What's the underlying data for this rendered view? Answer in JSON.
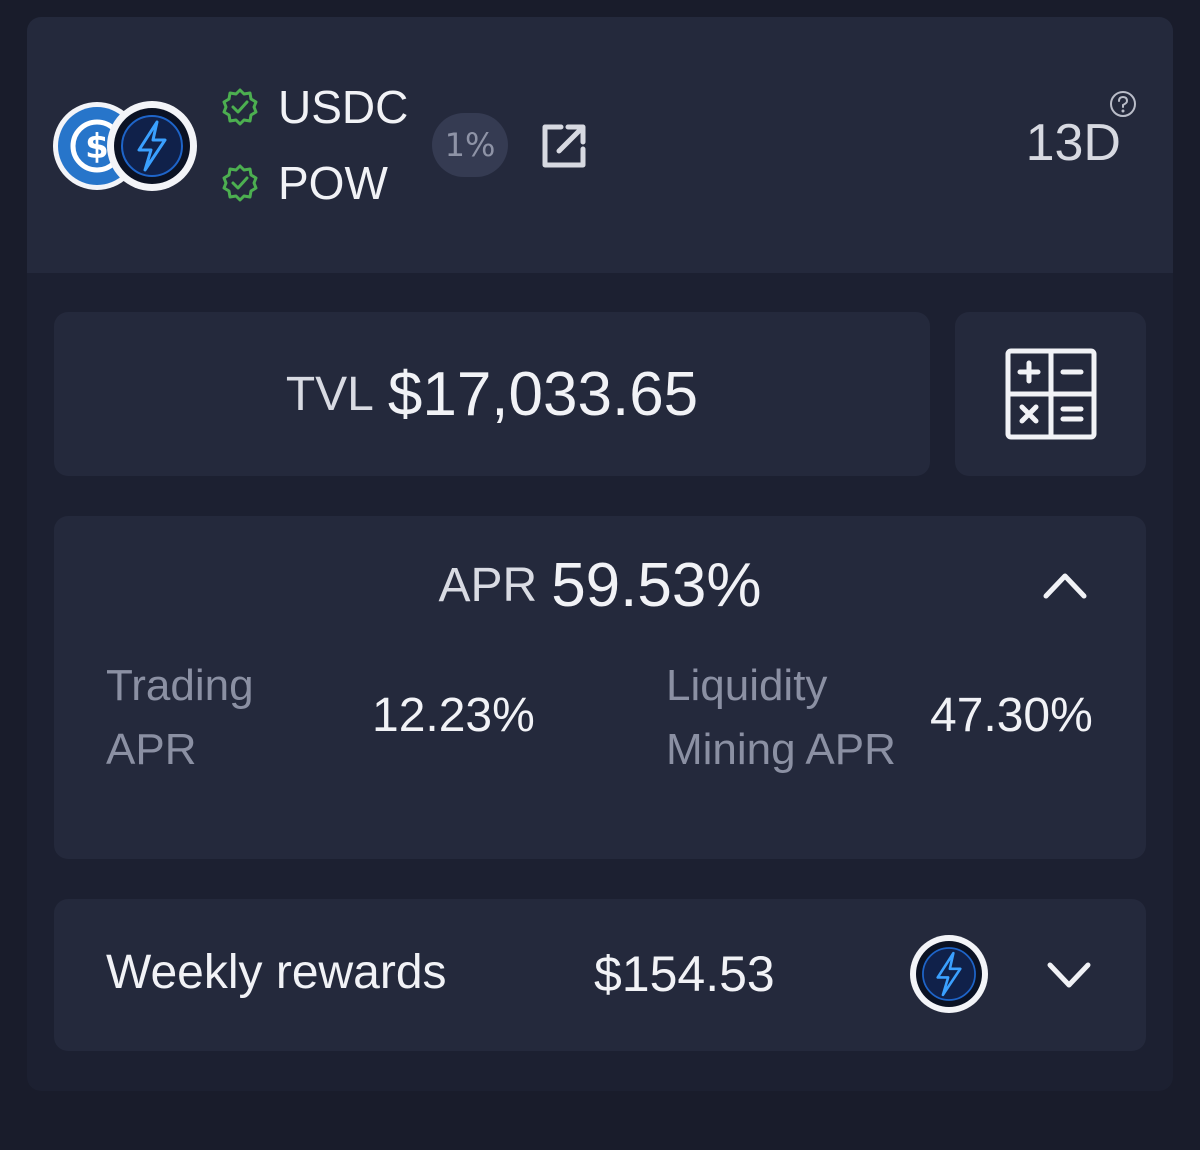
{
  "pool": {
    "token_a": "USDC",
    "token_b": "POW",
    "fee_tier": "1%",
    "duration": "13D",
    "icons": {
      "token_a": "usdc-logo-icon",
      "token_b": "pow-lightning-icon",
      "verified": "verified-check-icon",
      "link": "external-link-icon",
      "help": "help-circle-icon"
    }
  },
  "tvl": {
    "label": "TVL",
    "value": "$17,033.65",
    "calculator_icon": "calculator-icon"
  },
  "apr": {
    "label": "APR",
    "value": "59.53%",
    "trading_label_line1": "Trading",
    "trading_label_line2": "APR",
    "trading_value": "12.23%",
    "lm_label_line1": "Liquidity",
    "lm_label_line2": "Mining APR",
    "lm_value": "47.30%",
    "toggle_icon": "chevron-up-icon"
  },
  "rewards": {
    "label": "Weekly rewards",
    "value": "$154.53",
    "token_icon": "pow-lightning-icon",
    "toggle_icon": "chevron-down-icon"
  },
  "colors": {
    "background": "#191c2b",
    "card": "#1c2031",
    "panel": "#24293c",
    "verified": "#4caf50",
    "usdc_blue": "#2775ca",
    "pow_bolt": "#3aa0ff",
    "muted_text": "#8b90a3"
  }
}
